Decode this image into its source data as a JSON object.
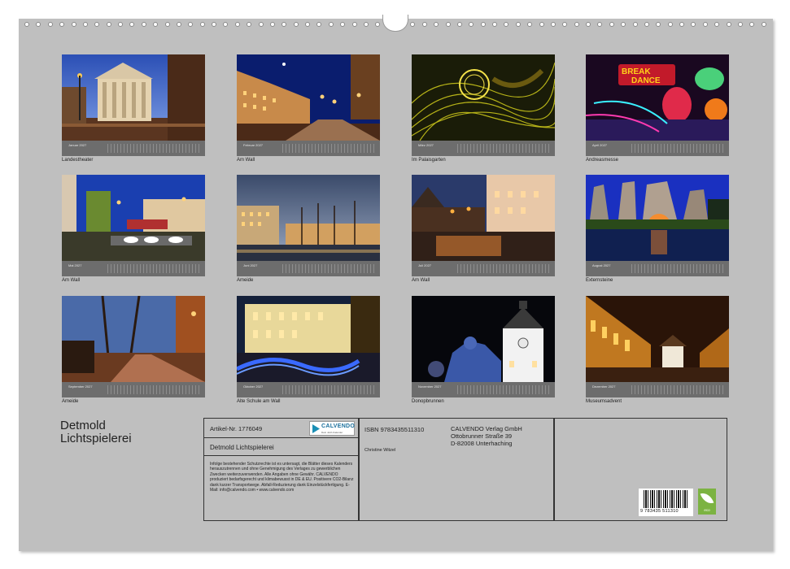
{
  "title_lines": [
    "Detmold",
    "Lichtspielerei"
  ],
  "months": [
    {
      "month": "Januar 2027",
      "caption": "Landestheater"
    },
    {
      "month": "Februar 2027",
      "caption": "Am Wall"
    },
    {
      "month": "März 2027",
      "caption": "Im Palaisgarten"
    },
    {
      "month": "April 2027",
      "caption": "Andreasmesse"
    },
    {
      "month": "Mai 2027",
      "caption": "Am Wall"
    },
    {
      "month": "Juni 2027",
      "caption": "Ameide"
    },
    {
      "month": "Juli 2027",
      "caption": "Am Wall"
    },
    {
      "month": "August 2027",
      "caption": "Externsteine"
    },
    {
      "month": "September 2027",
      "caption": "Ameide"
    },
    {
      "month": "Oktober 2027",
      "caption": "Alte Schule am Wall"
    },
    {
      "month": "November 2027",
      "caption": "Donopbrunnen"
    },
    {
      "month": "Dezember 2027",
      "caption": "Museumsadvent"
    }
  ],
  "info": {
    "article": "Artikel-Nr. 1776049",
    "calendar_title": "Detmold Lichtspielerei",
    "legal": "Infolge bestehender Schutzrechte ist es untersagt, die Blätter dieses Kalenders herauszutrennen und ohne Genehmigung des Verlages zu gewerblichen Zwecken weiterzuverwenden. Alle Angaben ohne Gewähr. CALVENDO produziert bedarfsgerecht und klimabewusst in DE & EU. Positivere CO2-Bilanz dank kurzer Transportwege. Abfall-Reduzierung dank Einzelstückfertigung. E-Mail: info@calvendo.com • www.calvendo.com",
    "isbn": "ISBN 9783435511310",
    "author": "Christine Witzel",
    "publisher": [
      "CALVENDO Verlag GmbH",
      "Ottobrunner Straße 39",
      "D-82008 Unterhaching"
    ],
    "barcode_number": "9 783435 511310",
    "logo_text": "CALVENDO",
    "logo_sub": "Dein Jetzt-Kalender",
    "eco_label": "eco"
  }
}
